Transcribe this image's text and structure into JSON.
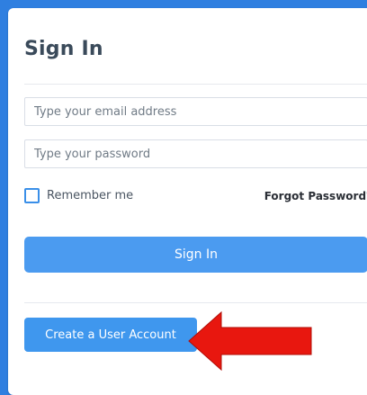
{
  "form": {
    "title": "Sign In",
    "email_placeholder": "Type your email address",
    "password_placeholder": "Type your password",
    "remember_label": "Remember me",
    "forgot_label": "Forgot Password?",
    "signin_label": "Sign In",
    "create_account_label": "Create a User Account"
  },
  "colors": {
    "background": "#2f7fe0",
    "primary_button": "#4b9bf0",
    "annotation_arrow": "#e8170f"
  },
  "icons": {
    "annotation": "red-arrow-icon"
  }
}
